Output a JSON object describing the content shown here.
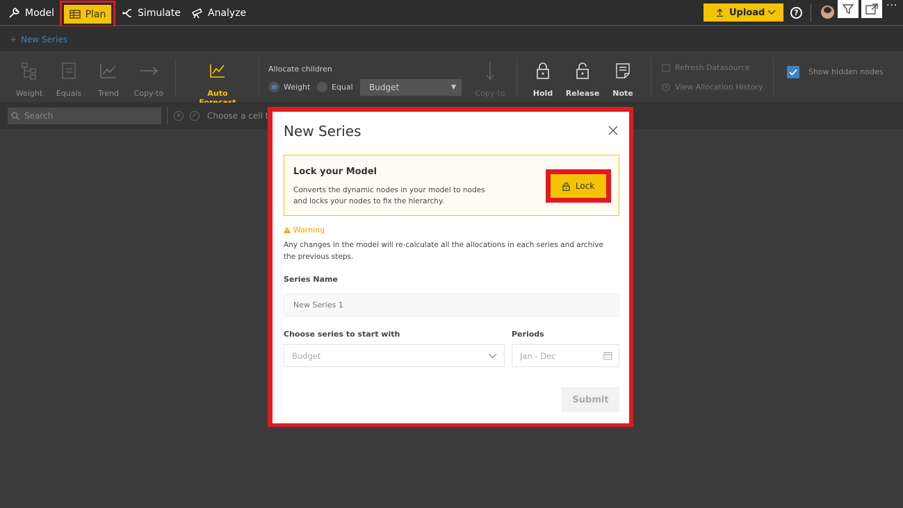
{
  "nav": {
    "model_label": "Model",
    "plan_label": "Plan",
    "simulate_label": "Simulate",
    "analyze_label": "Analyze",
    "upload_label": "Upload",
    "help_label": "?",
    "more_label": "···"
  },
  "subbar": {
    "new_series_plus": "+",
    "new_series_label": "New Series"
  },
  "ribbon": {
    "weight_label": "Weight",
    "equals_label": "Equals",
    "trend_label": "Trend",
    "copy_to_label": "Copy-to",
    "auto_forecast_label": "Auto Forecast",
    "allocate_title": "Allocate children",
    "radio_weight": "Weight",
    "radio_equal": "Equal",
    "budget_value": "Budget",
    "copy_to_2_label": "Copy-to",
    "hold_label": "Hold",
    "release_label": "Release",
    "note_label": "Note",
    "refresh_label": "Refresh Datasource",
    "history_label": "View Allocation History",
    "show_hidden_label": "Show hidden nodes"
  },
  "searchbar": {
    "search_placeholder": "Search",
    "choose_cell_text": "Choose a cell to"
  },
  "modal": {
    "title": "New Series",
    "lock_title": "Lock your Model",
    "lock_desc": "Converts the dynamic nodes in your model to nodes and locks your nodes to fix the hierarchy.",
    "lock_button": "Lock",
    "warning_title": "Warning",
    "warning_text": "Any changes in the model will re-calculate all the allocations in each series and archive the previous steps.",
    "series_name_label": "Series Name",
    "series_name_placeholder": "New Series 1",
    "choose_series_label": "Choose series to start with",
    "choose_series_value": "Budget",
    "periods_label": "Periods",
    "periods_value": "Jan - Dec",
    "submit_label": "Submit"
  },
  "colors": {
    "accent": "#f5c400",
    "highlight": "#e11b22",
    "link": "#3a84c4"
  }
}
